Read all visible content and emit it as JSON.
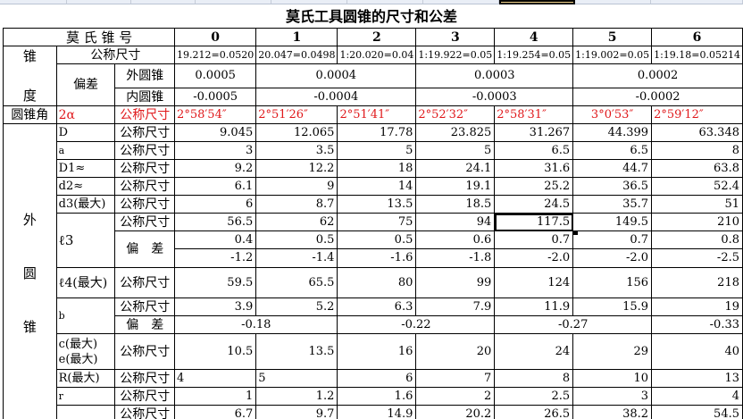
{
  "title": "莫氏工具圆锥的尺寸和公差",
  "header": {
    "label": "莫 氏 锥 号",
    "numbers": [
      "0",
      "1",
      "2",
      "3",
      "4",
      "5",
      "6"
    ]
  },
  "side": {
    "taper": "锥\n\n度",
    "outer": [
      "外",
      "圆",
      "锥"
    ]
  },
  "taper": {
    "label": "公称尺寸",
    "values": [
      "19.212=0.0520",
      "20.047=0.0498",
      "1:20.020=0.04",
      "1:19.922=0.05",
      "1:19.254=0.05",
      "1:19.002=0.05",
      "1:19.18=0.05214"
    ]
  },
  "deviation": {
    "label": "偏差",
    "outer": {
      "label": "外圆锥",
      "values": [
        "0.0005",
        "0.0004",
        "0.0003",
        "0.0002"
      ]
    },
    "inner": {
      "label": "内圆锥",
      "values": [
        "-0.0005",
        "-0.0004",
        "-0.0003",
        "-0.0002"
      ]
    }
  },
  "angle": {
    "side": "圆锥角",
    "symbol": "2α",
    "label": "公称尺寸",
    "values": [
      "2°58′54″",
      "2°51′26″",
      "2°51′41″",
      "2°52′32″",
      "2°58′31″",
      "3°0′53″",
      "2°59′12″"
    ]
  },
  "nominal": "公称尺寸",
  "tolerance": "偏　差",
  "rows": {
    "D": {
      "name": "D",
      "v": [
        "9.045",
        "12.065",
        "17.78",
        "23.825",
        "31.267",
        "44.399",
        "63.348"
      ]
    },
    "a": {
      "name": "a",
      "v": [
        "3",
        "3.5",
        "5",
        "5",
        "6.5",
        "6.5",
        "8"
      ]
    },
    "D1": {
      "name": "D1≈",
      "v": [
        "9.2",
        "12.2",
        "18",
        "24.1",
        "31.6",
        "44.7",
        "63.8"
      ]
    },
    "d2": {
      "name": "d2≈",
      "v": [
        "6.1",
        "9",
        "14",
        "19.1",
        "25.2",
        "36.5",
        "52.4"
      ]
    },
    "d3": {
      "name": "d3(最大)",
      "v": [
        "6",
        "8.7",
        "13.5",
        "18.5",
        "24.5",
        "35.7",
        "51"
      ]
    },
    "l3": {
      "name": "ℓ3",
      "v": [
        "56.5",
        "62",
        "75",
        "94",
        "117.5",
        "149.5",
        "210"
      ],
      "up": [
        "0.4",
        "0.5",
        "0.5",
        "0.6",
        "0.7",
        "0.7",
        "0.8"
      ],
      "dn": [
        "-1.2",
        "-1.4",
        "-1.6",
        "-1.8",
        "-2.0",
        "-2.0",
        "-2.5"
      ]
    },
    "l4": {
      "name": "ℓ4(最大)",
      "v": [
        "59.5",
        "65.5",
        "80",
        "99",
        "124",
        "156",
        "218"
      ]
    },
    "b": {
      "name": "b",
      "v": [
        "3.9",
        "5.2",
        "6.3",
        "7.9",
        "11.9",
        "15.9",
        "19"
      ],
      "tol": [
        "-0.18",
        "-0.22",
        "-0.27",
        "-0.33"
      ]
    },
    "ce": {
      "name": [
        "c(最大)",
        "e(最大)"
      ],
      "v": [
        "10.5",
        "13.5",
        "16",
        "20",
        "24",
        "29",
        "40"
      ]
    },
    "R": {
      "name": "R(最大)",
      "v": [
        "4",
        "5",
        "6",
        "7",
        "8",
        "10",
        "13"
      ]
    },
    "r": {
      "name": "r",
      "v": [
        "1",
        "1.2",
        "1.6",
        "2",
        "2.5",
        "3",
        "4"
      ]
    },
    "last": {
      "v": [
        "6.7",
        "9.7",
        "14.9",
        "20.2",
        "26.5",
        "38.2",
        "54.5"
      ]
    }
  }
}
